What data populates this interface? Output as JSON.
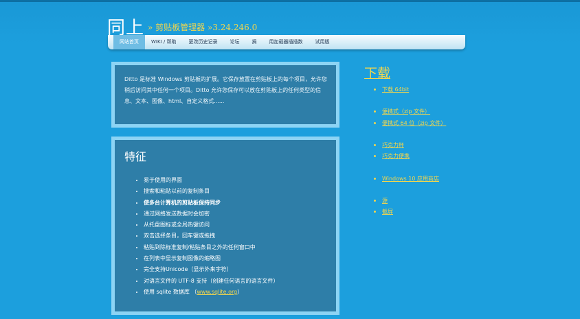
{
  "header": {
    "logo": "同上",
    "subtitle": "» 剪贴板管理器 »3.24.246.0"
  },
  "nav": {
    "items": [
      {
        "label": "网站首页",
        "active": true
      },
      {
        "label": "WIKI / 帮助",
        "active": false
      },
      {
        "label": "更改历史记录",
        "active": false
      },
      {
        "label": "论坛",
        "active": false
      },
      {
        "label": "捐",
        "active": false
      },
      {
        "label": "用加载器插插数",
        "active": false
      },
      {
        "label": "试用版",
        "active": false
      }
    ]
  },
  "intro": {
    "text": "Ditto 是标准 Windows 剪贴板的扩展。它保存放置在剪贴板上的每个项目，允许您稍后访问其中任何一个项目。Ditto 允许您保存可以放在剪贴板上的任何类型的信息、文本、图像、html、自定义格式......"
  },
  "features": {
    "title": "特征",
    "items": [
      "易于使用的界面",
      "搜索和粘贴以前的复制条目",
      "使多台计算机的剪贴板保持同步",
      "通过网络发送数据时会加密",
      "从托盘图标或全局热键访问",
      "双击选择条目，回车键或拖拽",
      "粘贴到除标准复制/粘贴条目之外的任何窗口中",
      "在列表中显示复制图像的缩略图",
      "完全支持Unicode（显示外来字符）",
      "对语言文件的 UTF-8 支持（创建任何语言的语言文件）"
    ],
    "sqlite_prefix": "使用 sqlite 数据库 （",
    "sqlite_link": "www.sqlite.org",
    "sqlite_suffix": "）"
  },
  "downloads": {
    "title": "下载",
    "links": [
      "下载 64bit",
      "便携式（zip 文件）",
      "便携式 64 位（zip 文件）",
      "巧克力杯",
      "巧克力便携",
      "Windows 10 应用商店",
      "源",
      "截屏"
    ]
  }
}
